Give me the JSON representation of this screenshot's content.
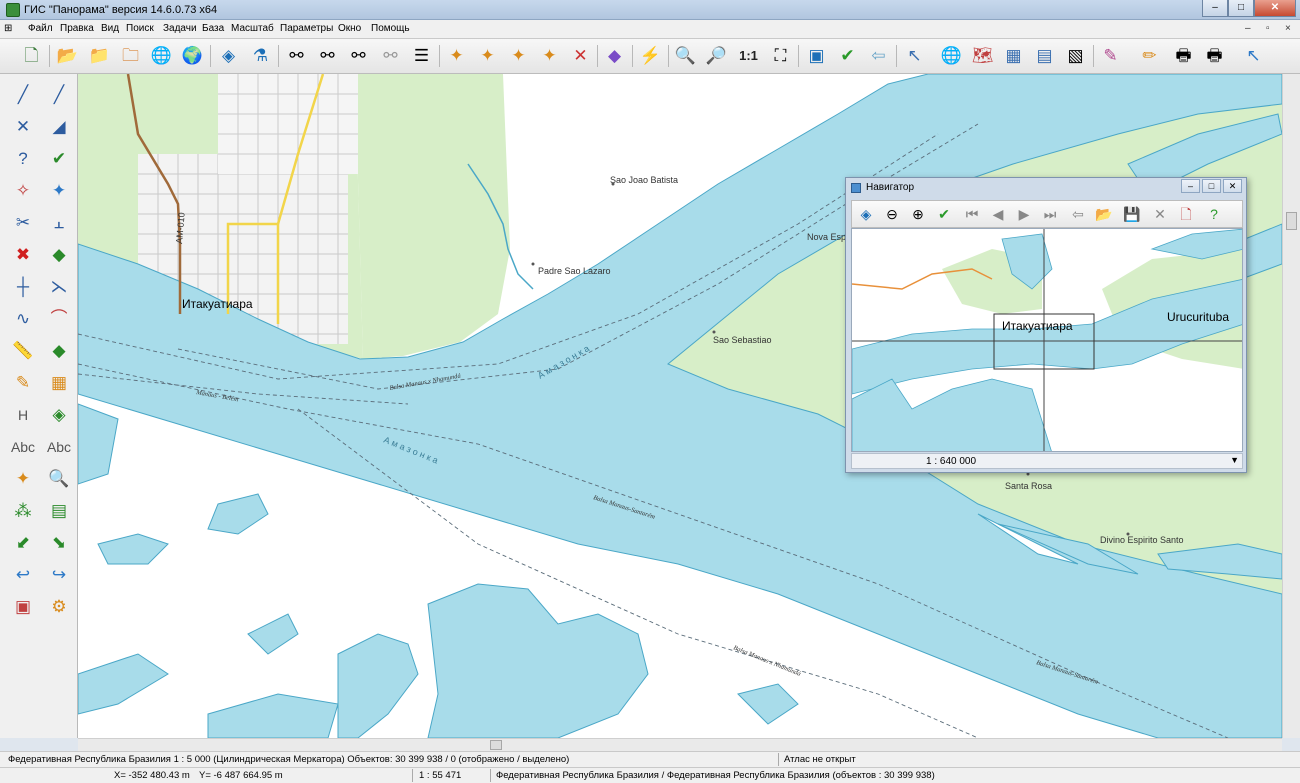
{
  "window": {
    "title": "ГИС \"Панорама\" версия 14.6.0.73 x64",
    "minimize_glyph": "–",
    "maximize_glyph": "□",
    "close_glyph": "✕"
  },
  "menu": {
    "items": [
      "Файл",
      "Правка",
      "Вид",
      "Поиск",
      "Задачи",
      "База",
      "Масштаб",
      "Параметры",
      "Окно",
      "Помощь"
    ],
    "mdi_controls": [
      "–",
      "▫",
      "×"
    ]
  },
  "toolbar": {
    "zoom_1to1_label": "1:1"
  },
  "left_tools": {
    "text_tool_1": "Abc",
    "text_tool_2": "Abc",
    "height_tool": "H"
  },
  "map": {
    "labels": {
      "city_itacoatiara": "Итакуатиара",
      "road_am010": "AM-010",
      "sao_joao_batista": "Sao Joao Batista",
      "padre_sao_lazaro": "Padre Sao Lazaro",
      "sao_sebastiao": "Sao Sebastiao",
      "nova_esp": "Nova Esp",
      "santa_rosa": "Santa Rosa",
      "divino_espirito_santo": "Divino Espirito Santo",
      "river_1": "А м а з о н к а",
      "river_2": "А м а з о н к а",
      "route_balsa_nhamunda_1": "Balsa Manaus x Nhamundá",
      "route_balsa_nhamunda_2": "Balsa Manaus x Nhamundá",
      "route_manaus_belem": "Manaus - Belém",
      "route_balsa_santarem_1": "Balsa Manaus-Santarém",
      "route_balsa_santarem_2": "Balsa Manaus-Santarém"
    },
    "colors": {
      "water": "#a8dcea",
      "water_edge": "#4aa7c7",
      "vegetation": "#d7eec8",
      "land": "#ffffff",
      "road_major": "#f2d54a",
      "road_brown": "#a06a3a"
    }
  },
  "navigator": {
    "title": "Навигатор",
    "scale": "1 : 640 000",
    "labels": {
      "city": "Итакуатиара",
      "urucurituba": "Urucurituba"
    },
    "window_controls": [
      "–",
      "□",
      "✕"
    ]
  },
  "status": {
    "left": "Федеративная Республика Бразилия   1 : 5 000 (Цилиндрическая Меркатора) Объектов: 30 399 938 / 0 (отображено / выделено)",
    "atlas": "Атлас не открыт",
    "x": "X=   -352 480.43 m",
    "y": "Y=   -6 487 664.95 m",
    "scale": "1 : 55 471",
    "path": "Федеративная Республика Бразилия / Федеративная Республика Бразилия   (объектов : 30 399 938)"
  }
}
